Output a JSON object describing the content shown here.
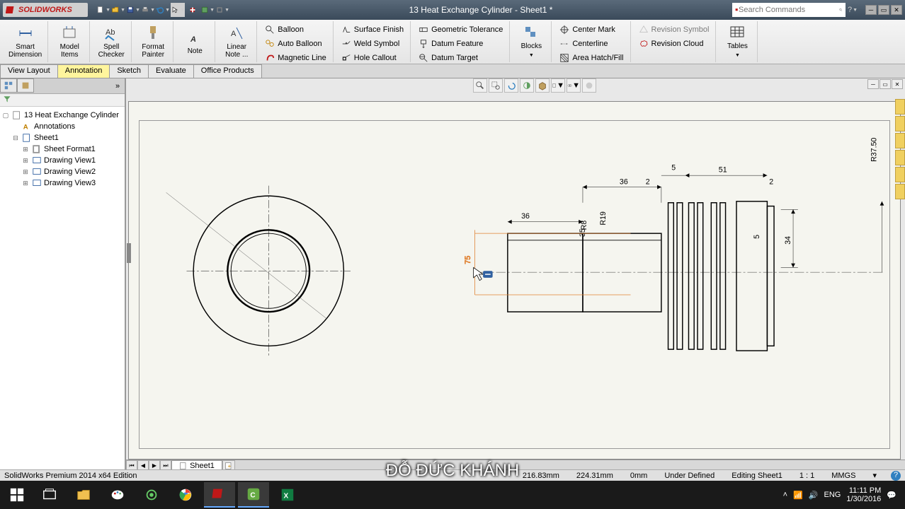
{
  "title": "13 Heat Exchange Cylinder - Sheet1 *",
  "logo": "SOLIDWORKS",
  "search": {
    "placeholder": "Search Commands"
  },
  "ribbon": {
    "smart_dimension": "Smart\nDimension",
    "model_items": "Model\nItems",
    "spell_checker": "Spell\nChecker",
    "format_painter": "Format\nPainter",
    "note": "Note",
    "linear_note": "Linear\nNote ...",
    "balloon": "Balloon",
    "auto_balloon": "Auto Balloon",
    "magnetic_line": "Magnetic Line",
    "surface_finish": "Surface Finish",
    "weld_symbol": "Weld Symbol",
    "hole_callout": "Hole Callout",
    "geometric_tolerance": "Geometric Tolerance",
    "datum_feature": "Datum Feature",
    "datum_target": "Datum Target",
    "center_mark": "Center Mark",
    "centerline": "Centerline",
    "area_hatch": "Area Hatch/Fill",
    "revision_symbol": "Revision Symbol",
    "revision_cloud": "Revision Cloud",
    "blocks": "Blocks",
    "tables": "Tables"
  },
  "tabs": {
    "view_layout": "View Layout",
    "annotation": "Annotation",
    "sketch": "Sketch",
    "evaluate": "Evaluate",
    "office_products": "Office Products"
  },
  "tree": {
    "root": "13 Heat Exchange Cylinder",
    "annotations": "Annotations",
    "sheet1": "Sheet1",
    "sheet_format": "Sheet Format1",
    "view1": "Drawing View1",
    "view2": "Drawing View2",
    "view3": "Drawing View3"
  },
  "sheet_tab": "Sheet1",
  "status": {
    "edition": "SolidWorks Premium 2014 x64 Edition",
    "x": "216.83mm",
    "y": "224.31mm",
    "z": "0mm",
    "state": "Under Defined",
    "editing": "Editing Sheet1",
    "scale": "1 : 1",
    "units": "MMGS"
  },
  "tray": {
    "lang": "ENG",
    "time": "11:11 PM",
    "date": "1/30/2016"
  },
  "subtitle": "ĐỖ ĐỨC KHÁNH",
  "dims": {
    "d36a": "36",
    "d2a": "2",
    "d5": "5",
    "d51": "51",
    "d2b": "2",
    "d36b": "36",
    "r19": "R19",
    "r35": "35",
    "d75": "75",
    "d34": "34",
    "r3750": "R37.50",
    "d5b": "5",
    "r8": "R8"
  }
}
